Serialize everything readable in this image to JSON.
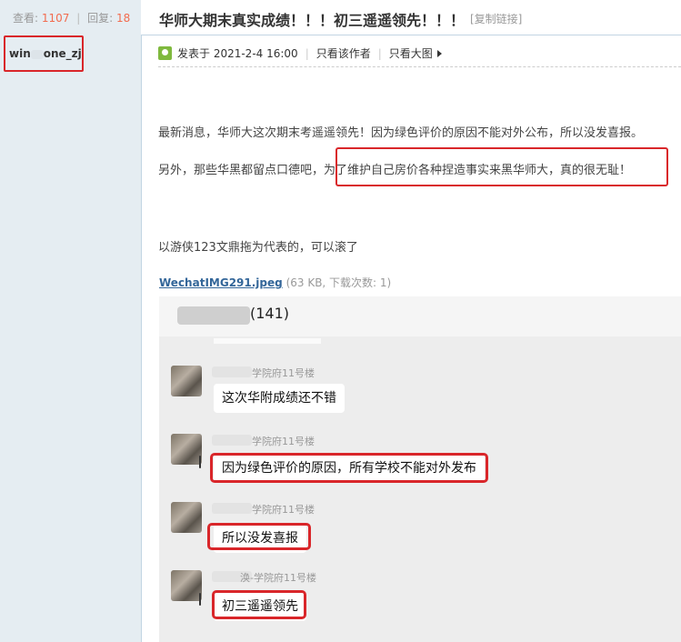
{
  "sidebar": {
    "views_label": "查看:",
    "views_count": "1107",
    "replies_label": "回复:",
    "replies_count": "18",
    "author_prefix": "win",
    "author_suffix": "one_zj"
  },
  "post": {
    "title": "华师大期末真实成绩！！！初三遥遥领先！！！",
    "copy_link": "[复制链接]",
    "posted_at": "发表于 2021-2-4 16:00",
    "only_author": "只看该作者",
    "large_image": "只看大图",
    "paragraphs": [
      "最新消息，华师大这次期末考遥遥领先！因为绿色评价的原因不能对外公布，所以没发喜报。",
      "另外，那些华黑都留点口德吧，为了维护自己房价各种捏造事实来黑华师大，真的很无耻！",
      "以游侠123文鼎拖为代表的，可以滚了"
    ],
    "attachment_name": "WechatIMG291.jpeg",
    "attachment_info": "(63 KB, 下载次数: 1)"
  },
  "chat": {
    "group_count": "(141)",
    "messages": [
      {
        "sender": "学院府11号楼",
        "text": "这次华附成绩还不错"
      },
      {
        "sender": "学院府11号楼",
        "text": "因为绿色评价的原因，所有学校不能对外发布"
      },
      {
        "sender": "学院府11号楼",
        "text": "所以没发喜报"
      },
      {
        "sender": "涣-学院府11号楼",
        "text": "初三遥遥领先"
      }
    ]
  },
  "colors": {
    "accent_red": "#d9262a",
    "stat_number": "#f26c4f",
    "sidebar_bg": "#e5edf2",
    "link": "#336699"
  }
}
